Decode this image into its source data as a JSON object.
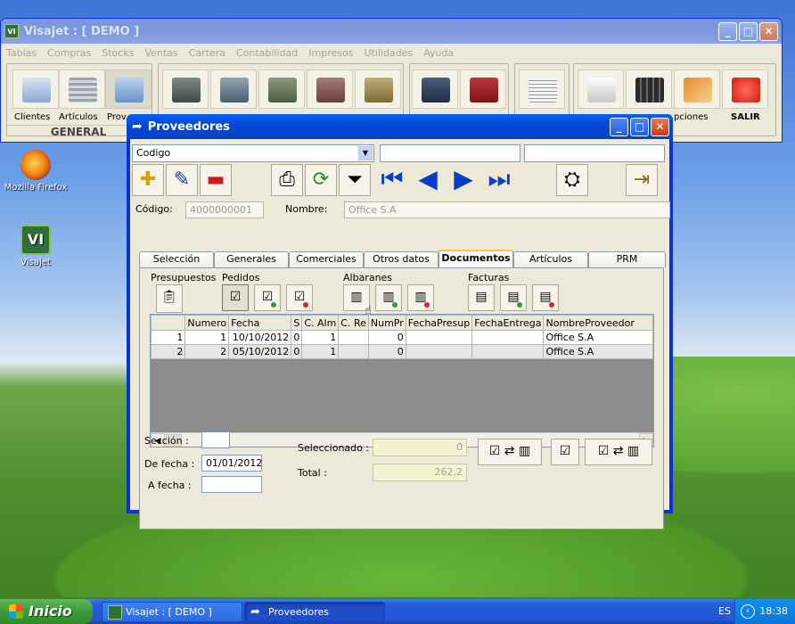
{
  "desktop": {
    "icons": [
      {
        "label": "Mozilla Firefox"
      },
      {
        "label": "Visajet"
      }
    ]
  },
  "main_window": {
    "title": "Visajet : [ DEMO ]",
    "menu": [
      "Tablas",
      "Compras",
      "Stocks",
      "Ventas",
      "Cartera",
      "Contabilidad",
      "Impresos",
      "Utilidades",
      "Ayuda"
    ],
    "toolbar_labels": {
      "clientes": "Clientes",
      "articulos": "Artículos",
      "proveedores": "Prov",
      "opciones": "pciones",
      "salir": "SALIR"
    },
    "general_group": "GENERAL"
  },
  "dialog": {
    "title": "Proveedores",
    "search_combo": "Codigo",
    "codigo_label": "Código:",
    "codigo_value": "4000000001",
    "nombre_label": "Nombre:",
    "nombre_value": "Office S.A",
    "tabs": [
      "Selección",
      "Generales",
      "Comerciales",
      "Otros datos",
      "Documentos",
      "Artículos",
      "PRM"
    ],
    "active_tab": "Documentos",
    "doc_groups": {
      "presupuestos": "Presupuestos",
      "pedidos": "Pedidos",
      "albaranes": "Albaranes",
      "facturas": "Facturas"
    },
    "table": {
      "columns": [
        "",
        "Numero",
        "Fecha",
        "S",
        "C. Alm",
        "C. Re",
        "NumPr",
        "FechaPresup",
        "FechaEntrega",
        "NombreProveedor"
      ],
      "rows": [
        [
          "1",
          "1",
          "10/10/2012",
          "0",
          "1",
          "",
          "0",
          "",
          "",
          "Office S.A"
        ],
        [
          "2",
          "2",
          "05/10/2012",
          "0",
          "1",
          "",
          "0",
          "",
          "",
          "Office S.A"
        ]
      ]
    },
    "footer": {
      "seccion_label": "Sección :",
      "seccion_value": "",
      "de_fecha_label": "De fecha :",
      "de_fecha_value": "01/01/2012",
      "a_fecha_label": "A fecha :",
      "a_fecha_value": "",
      "seleccionado_label": "Seleccionado :",
      "seleccionado_value": "0",
      "total_label": "Total :",
      "total_value": "262,2"
    }
  },
  "taskbar": {
    "start": "Inicio",
    "tasks": [
      "Visajet : [ DEMO ]",
      "Proveedores"
    ],
    "language": "ES",
    "clock": "18:38"
  }
}
